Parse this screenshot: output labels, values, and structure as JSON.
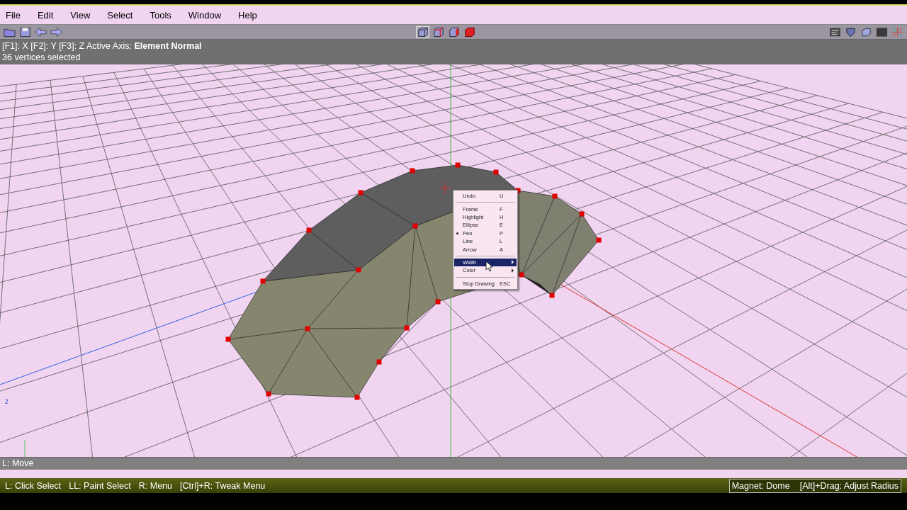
{
  "menu_bar": {
    "items": [
      "File",
      "Edit",
      "View",
      "Select",
      "Tools",
      "Window",
      "Help"
    ]
  },
  "toolbar": {
    "left_icons": [
      {
        "kind": "folder",
        "selected": false
      },
      {
        "kind": "save",
        "selected": false
      },
      {
        "kind": "back",
        "selected": false
      },
      {
        "kind": "forward",
        "selected": false
      }
    ],
    "center_icons": [
      {
        "kind": "cube-wire",
        "selected": true
      },
      {
        "kind": "cube-edge",
        "selected": false
      },
      {
        "kind": "cube-face",
        "selected": false
      },
      {
        "kind": "cube-solid",
        "selected": false
      }
    ],
    "right_icons": [
      {
        "kind": "panel",
        "selected": false
      },
      {
        "kind": "shield",
        "selected": false
      },
      {
        "kind": "cube",
        "selected": false
      },
      {
        "kind": "texture",
        "selected": false
      },
      {
        "kind": "axes",
        "selected": false
      }
    ]
  },
  "info_panel": {
    "axis_line": "[F1]: X   [F2]: Y   [F3]: Z   Active Axis: **Element Normal**",
    "selection": "36 vertices selected"
  },
  "viewport": {
    "axis_label": "z",
    "hint": "L: Move"
  },
  "context_menu": {
    "items": [
      {
        "kind": "item",
        "label": "Undo",
        "shortcut": "U",
        "checked": false,
        "selected": false,
        "submenu": false
      },
      {
        "kind": "separator"
      },
      {
        "kind": "item",
        "label": "Frame",
        "shortcut": "F",
        "checked": false,
        "selected": false,
        "submenu": false
      },
      {
        "kind": "item",
        "label": "Highlight",
        "shortcut": "H",
        "checked": false,
        "selected": false,
        "submenu": false
      },
      {
        "kind": "item",
        "label": "Ellipse",
        "shortcut": "E",
        "checked": false,
        "selected": false,
        "submenu": false
      },
      {
        "kind": "item",
        "label": "Pen",
        "shortcut": "P",
        "checked": true,
        "selected": false,
        "submenu": false
      },
      {
        "kind": "item",
        "label": "Line",
        "shortcut": "L",
        "checked": false,
        "selected": false,
        "submenu": false
      },
      {
        "kind": "item",
        "label": "Arrow",
        "shortcut": "A",
        "checked": false,
        "selected": false,
        "submenu": false
      },
      {
        "kind": "separator"
      },
      {
        "kind": "item",
        "label": "Width",
        "checked": false,
        "selected": true,
        "submenu": true
      },
      {
        "kind": "item",
        "label": "Color",
        "checked": false,
        "selected": false,
        "submenu": true
      },
      {
        "kind": "separator"
      },
      {
        "kind": "item",
        "label": "Stop Drawing",
        "shortcut": "ESC",
        "checked": false,
        "selected": false,
        "submenu": false
      }
    ]
  },
  "status_bar": {
    "hints": [
      "L: Click Select",
      "LL: Paint Select",
      "R: Menu",
      "[Ctrl]+R: Tweak Menu"
    ],
    "magnet": [
      "Magnet: Dome",
      "[Alt]+Drag: Adjust Radius"
    ]
  }
}
